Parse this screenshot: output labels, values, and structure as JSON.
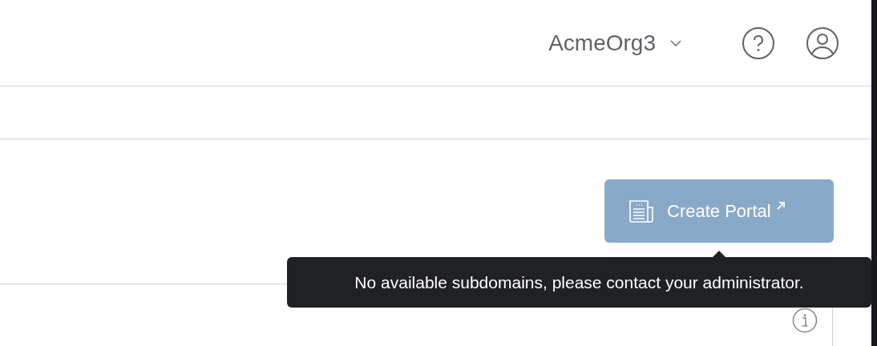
{
  "header": {
    "org_switcher": {
      "label": "AcmeOrg3"
    }
  },
  "create_button": {
    "label": "Create Portal",
    "disabled": true
  },
  "tooltip": {
    "text": "No available subdomains, please contact your administrator."
  }
}
